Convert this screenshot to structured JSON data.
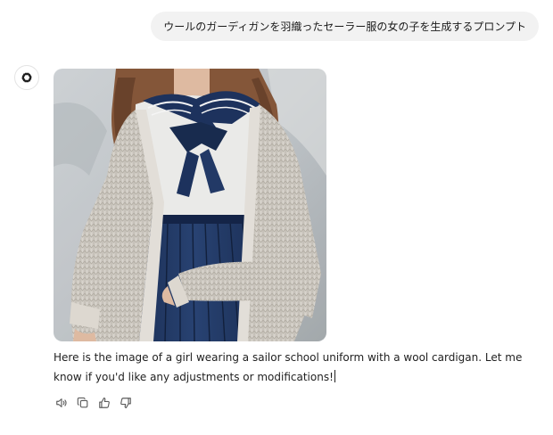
{
  "user_message": {
    "text": "ウールのガーディガンを羽織ったセーラー服の女の子を生成するプロンプト"
  },
  "assistant": {
    "avatar_icon": "openai-logo-icon",
    "reply_text": "Here is the image of a girl wearing a sailor school uniform with a wool cardigan. Let me know if you'd like any adjustments or modifications!",
    "actions": [
      {
        "icon": "read-aloud-icon"
      },
      {
        "icon": "copy-icon"
      },
      {
        "icon": "thumbs-up-icon"
      },
      {
        "icon": "thumbs-down-icon"
      }
    ]
  },
  "colors": {
    "bubble_bg": "#f2f2f2",
    "navy": "#1f3561",
    "cardigan": "#d9d4cc",
    "icon": "#5d5d5d"
  }
}
